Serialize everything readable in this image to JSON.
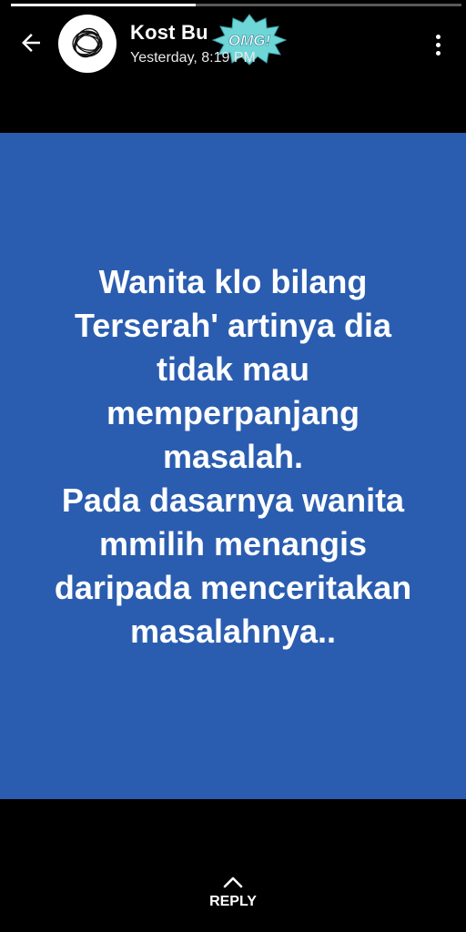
{
  "story": {
    "progress_fraction": 0.41,
    "author": "Kost Bu",
    "timestamp": "Yesterday, 8:19 PM",
    "sticker_text": "OMG!",
    "text": "Wanita klo bilang\nTerserah' artinya dia\ntidak mau\nmemperpanjang\nmasalah.\nPada dasarnya wanita\nmmilih menangis\ndaripada menceritakan\nmasalahnya..",
    "background_color": "#2a5db0"
  },
  "header": {
    "back_icon": "arrow-left-icon",
    "menu_icon": "more-vertical-icon",
    "avatar_icon": "scribble-avatar-icon"
  },
  "reply": {
    "label": "REPLY",
    "icon": "chevron-up-icon"
  }
}
